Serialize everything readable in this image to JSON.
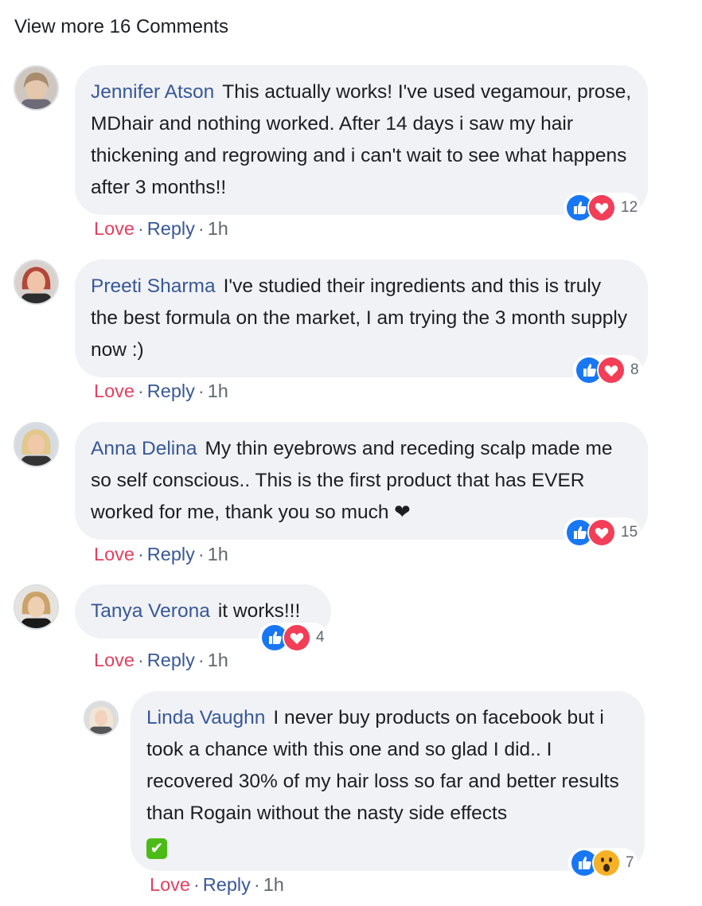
{
  "view_more": "View more 16 Comments",
  "comments": [
    {
      "author": "Jennifer Atson",
      "text": "This actually works! I've used vegamour, prose, MDhair and nothing worked. After 14 days i saw my hair thickening and regrowing and i can't wait to see what happens after 3 months!!",
      "reactions": [
        "like",
        "love"
      ],
      "reaction_count": "12",
      "love": "Love",
      "reply": "Reply",
      "time": "1h"
    },
    {
      "author": "Preeti Sharma",
      "text": "I've studied their ingredients and this is truly the best formula on the market, I am trying the 3 month supply now :)",
      "reactions": [
        "like",
        "love"
      ],
      "reaction_count": "8",
      "love": "Love",
      "reply": "Reply",
      "time": "1h"
    },
    {
      "author": "Anna Delina",
      "text": "My thin eyebrows and receding scalp made me so self conscious.. This is the first product that has EVER worked for me, thank you so much ❤",
      "reactions": [
        "like",
        "love"
      ],
      "reaction_count": "15",
      "love": "Love",
      "reply": "Reply",
      "time": "1h"
    },
    {
      "author": "Tanya Verona",
      "text": "it works!!!",
      "reactions": [
        "like",
        "love"
      ],
      "reaction_count": "4",
      "love": "Love",
      "reply": "Reply",
      "time": "1h"
    },
    {
      "author": "Linda Vaughn",
      "text": "I never buy products on facebook but i took a chance with this one and so glad I did.. I recovered 30% of my hair loss so far and better results than Rogain without the nasty side effects",
      "emoji": "✔",
      "reactions": [
        "like",
        "wow"
      ],
      "reaction_count": "7",
      "love": "Love",
      "reply": "Reply",
      "time": "1h"
    }
  ],
  "colors": {
    "author": "#385898",
    "love_action": "#e4405f",
    "bubble_bg": "#f0f2f5",
    "like": "#1877f2",
    "love": "#f33e58",
    "wow": "#f7b125"
  }
}
